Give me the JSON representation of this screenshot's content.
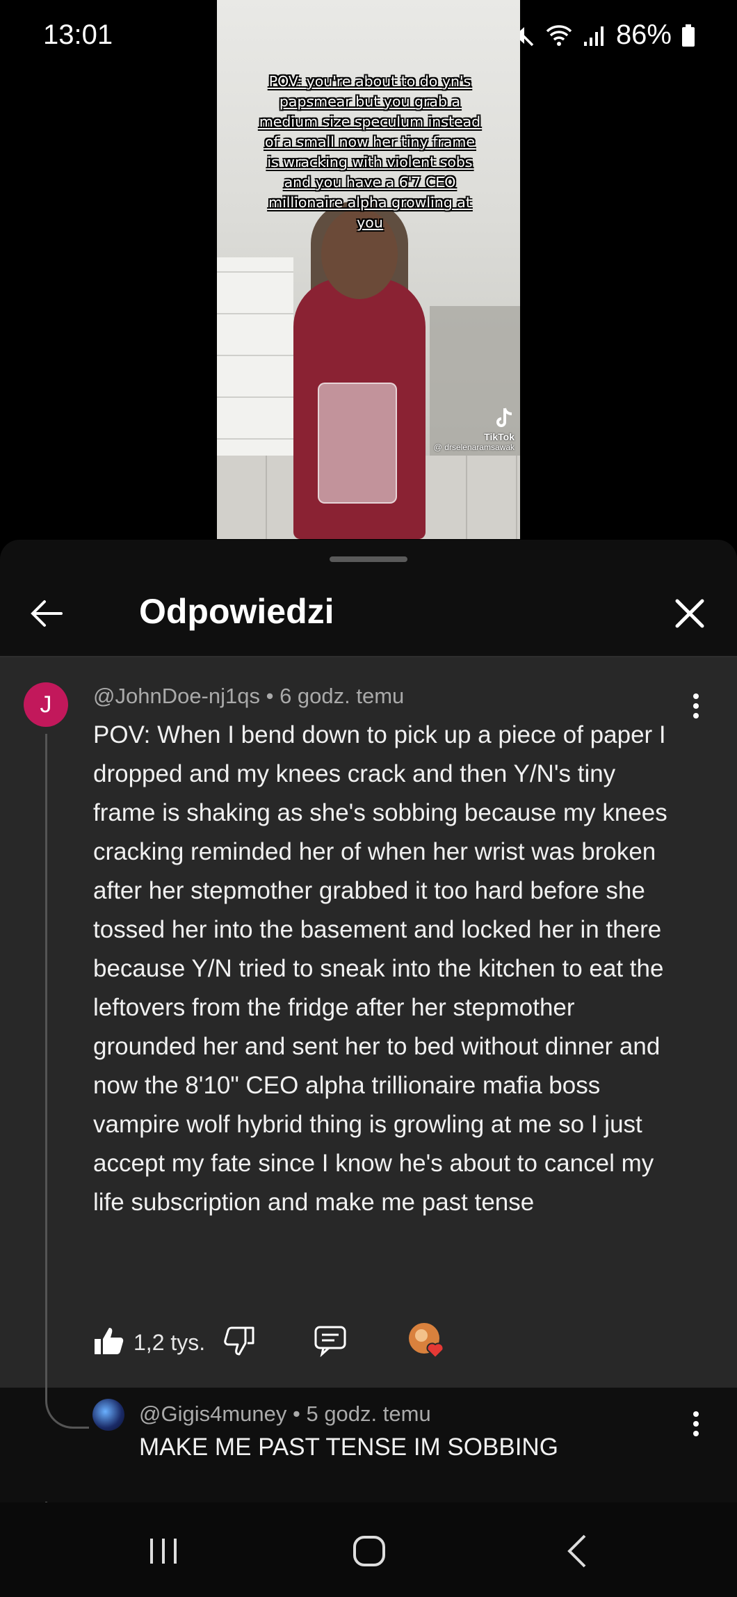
{
  "status_bar": {
    "time": "13:01",
    "battery": "86%",
    "icons": [
      "alarm-icon",
      "mute-icon",
      "wifi-icon",
      "signal-icon",
      "battery-icon"
    ]
  },
  "video": {
    "caption": "POV: you're about to do yn's papsmear but you grab a medium size speculum instead of a small now her tiny frame is wracking with violent sobs and you have a 6'7 CEO millionaire alpha growling at you",
    "watermark_brand": "TikTok",
    "watermark_user": "@ drselenaramsawak"
  },
  "sheet": {
    "title": "Odpowiedzi",
    "back_icon": "back-arrow-icon",
    "close_icon": "close-icon"
  },
  "comment": {
    "avatar_letter": "J",
    "avatar_color": "#c2185b",
    "meta": "@JohnDoe-nj1qs • 6 godz. temu",
    "text": "POV: When I bend down to pick up a piece of paper I dropped and my knees crack and then Y/N's tiny frame is shaking as she's sobbing because my knees cracking reminded her of when her wrist was broken after her stepmother grabbed it too hard before she tossed her into the basement and locked her in there because Y/N tried to sneak into the kitchen to eat the leftovers from the fridge after her stepmother grounded her and sent her to bed without dinner and now the 8'10\" CEO alpha trillionaire mafia boss vampire wolf hybrid thing is growling at me so I just accept my fate since I know he's about to cancel my life subscription and make me past tense",
    "likes": "1,2 tys."
  },
  "reply": {
    "meta": "@Gigis4muney • 5 godz. temu",
    "text": "MAKE ME PAST TENSE IM SOBBING"
  },
  "navbar": {
    "buttons": [
      "recent-apps-icon",
      "home-icon",
      "back-nav-icon"
    ]
  }
}
